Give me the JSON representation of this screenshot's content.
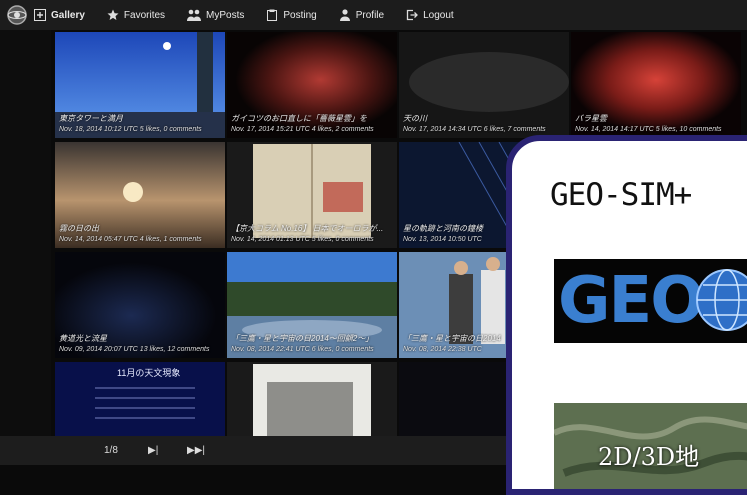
{
  "nav": {
    "gallery": "Gallery",
    "favorites": "Favorites",
    "myposts": "MyPosts",
    "posting": "Posting",
    "profile": "Profile",
    "logout": "Logout"
  },
  "tiles": [
    {
      "title": "東京タワーと満月",
      "meta": "Nov. 18, 2014 10:12 UTC  5 likes, 0 comments"
    },
    {
      "title": "ガイコツのお口直しに「薔薇星雲」を",
      "meta": "Nov. 17, 2014 15:21 UTC  4 likes, 2 comments"
    },
    {
      "title": "天の川",
      "meta": "Nov. 17, 2014 14:34 UTC  6 likes, 7 comments"
    },
    {
      "title": "バラ星雲",
      "meta": "Nov. 14, 2014 14:17 UTC  5 likes, 10 comments"
    },
    {
      "title": "霧の日の出",
      "meta": "Nov. 14, 2014 05:47 UTC  4 likes, 1 comments"
    },
    {
      "title": "【京大コラム No.16】 日本でオーロラが...",
      "meta": "Nov. 14, 2014 01:13 UTC  5 likes, 0 comments"
    },
    {
      "title": "星の軌跡と河南の鐘楼",
      "meta": "Nov. 13, 2014 10:50 UTC"
    },
    {
      "title": "",
      "meta": ""
    },
    {
      "title": "黄道光と流星",
      "meta": "Nov. 09, 2014 20:07 UTC  13 likes, 12 comments"
    },
    {
      "title": "「三鷹・星と宇宙の日2014〜回顧2〜」",
      "meta": "Nov. 08, 2014 22:41 UTC  6 likes, 0 comments"
    },
    {
      "title": "「三鷹・星と宇宙の日2014",
      "meta": "Nov. 08, 2014 22:38 UTC"
    },
    {
      "title": "",
      "meta": ""
    },
    {
      "title": "",
      "meta": ""
    },
    {
      "title": "",
      "meta": ""
    },
    {
      "title": "",
      "meta": ""
    },
    {
      "title": "",
      "meta": ""
    }
  ],
  "slide_text": "11月の天文現象",
  "pager": {
    "page": "1/8",
    "next": "▶|",
    "last": "▶▶|"
  },
  "overlay": {
    "title": "GEO-SIM+",
    "geo": "GEO",
    "map": "2D/3D地"
  }
}
